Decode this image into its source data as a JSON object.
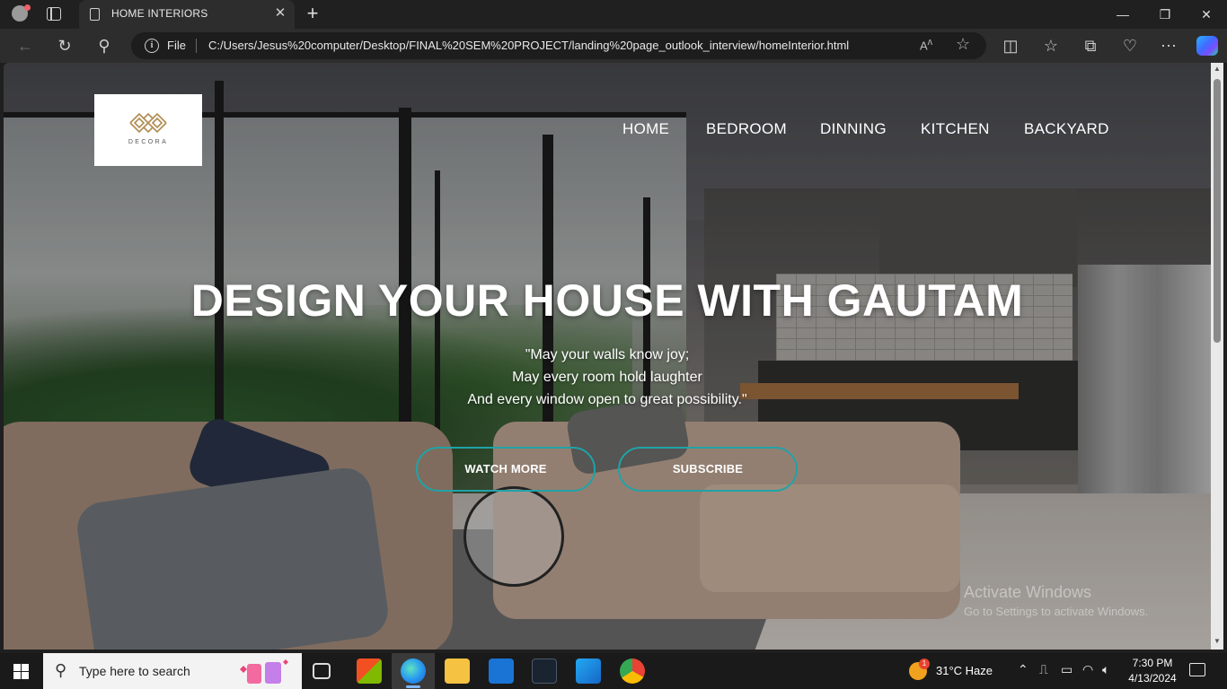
{
  "browser": {
    "tab_title": "HOME INTERIORS",
    "new_tab_symbol": "+",
    "address_label": "File",
    "url": "C:/Users/Jesus%20computer/Desktop/FINAL%20SEM%20PROJECT/landing%20page_outlook_interview/homeInterior.html",
    "icons": [
      "back-arrow-icon",
      "refresh-icon",
      "search-icon",
      "info-icon",
      "read-aloud-icon",
      "favorite-star-icon",
      "split-screen-icon",
      "favorites-icon",
      "collections-icon",
      "extensions-icon",
      "more-icon",
      "copilot-icon"
    ]
  },
  "page": {
    "logo_text": "DECORA",
    "menu": [
      {
        "label": "HOME"
      },
      {
        "label": "BEDROOM"
      },
      {
        "label": "DINNING"
      },
      {
        "label": "KITCHEN"
      },
      {
        "label": "BACKYARD"
      }
    ],
    "hero": {
      "title": "DESIGN YOUR HOUSE WITH GAUTAM",
      "quote_lines": [
        "\"May your walls know joy;",
        "May every room hold laughter",
        "And every window open to great possibility.\""
      ]
    },
    "buttons": {
      "watch_more": "WATCH MORE",
      "subscribe": "SUBSCRIBE"
    },
    "accent_color": "#1fa3a7"
  },
  "watermark": {
    "line1": "Activate Windows",
    "line2": "Go to Settings to activate Windows."
  },
  "taskbar": {
    "search_placeholder": "Type here to search",
    "weather": {
      "badge": "1",
      "text": "31°C  Haze"
    },
    "time": "7:30 PM",
    "date": "4/13/2024"
  }
}
